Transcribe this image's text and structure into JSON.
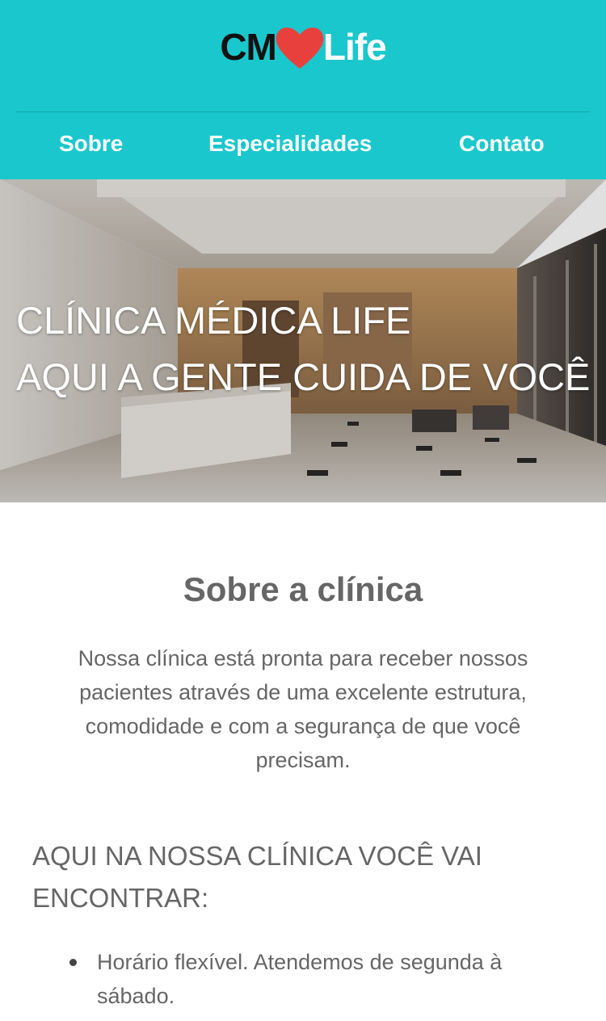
{
  "logo": {
    "cm": "CM",
    "life": "Life",
    "heart_color": "#e8413d"
  },
  "nav": {
    "items": [
      "Sobre",
      "Especialidades",
      "Contato"
    ]
  },
  "hero": {
    "line1": "CLÍNICA MÉDICA LIFE",
    "line2": "AQUI A GENTE CUIDA DE VOCÊ"
  },
  "about": {
    "title": "Sobre a clínica",
    "text": "Nossa clínica está pronta para receber nossos pacientes através de uma excelente estrutura, comodidade e com a segurança de que você precisam."
  },
  "features": {
    "title": "AQUI NA NOSSA CLÍNICA VOCÊ VAI ENCONTRAR:",
    "items": [
      "Horário flexível. Atendemos de segunda à sábado."
    ]
  },
  "colors": {
    "header_bg": "#1ac7cc",
    "text": "#666666"
  }
}
